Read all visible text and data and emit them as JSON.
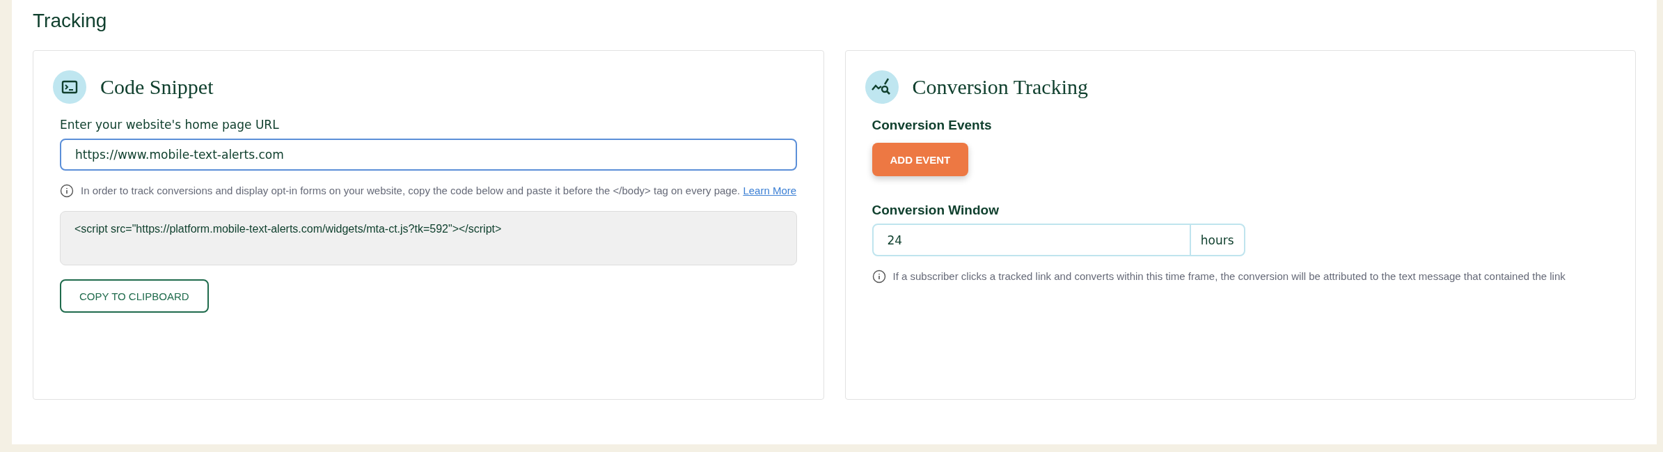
{
  "page_title": "Tracking",
  "code_snippet": {
    "title": "Code Snippet",
    "url_label": "Enter your website's home page URL",
    "url_value": "https://www.mobile-text-alerts.com",
    "info_text": "In order to track conversions and display opt-in forms on your website, copy the code below and paste it before the </body> tag on every page.",
    "info_link": "Learn More",
    "code": "<script src=\"https://platform.mobile-text-alerts.com/widgets/mta-ct.js?tk=592\"></script>",
    "copy_button": "COPY TO CLIPBOARD"
  },
  "conversion_tracking": {
    "title": "Conversion Tracking",
    "events_label": "Conversion Events",
    "add_button": "ADD EVENT",
    "window_label": "Conversion Window",
    "window_value": "24",
    "window_unit": "hours",
    "info_text": "If a subscriber clicks a tracked link and converts within this time frame, the conversion will be attributed to the text message that contained the link"
  }
}
